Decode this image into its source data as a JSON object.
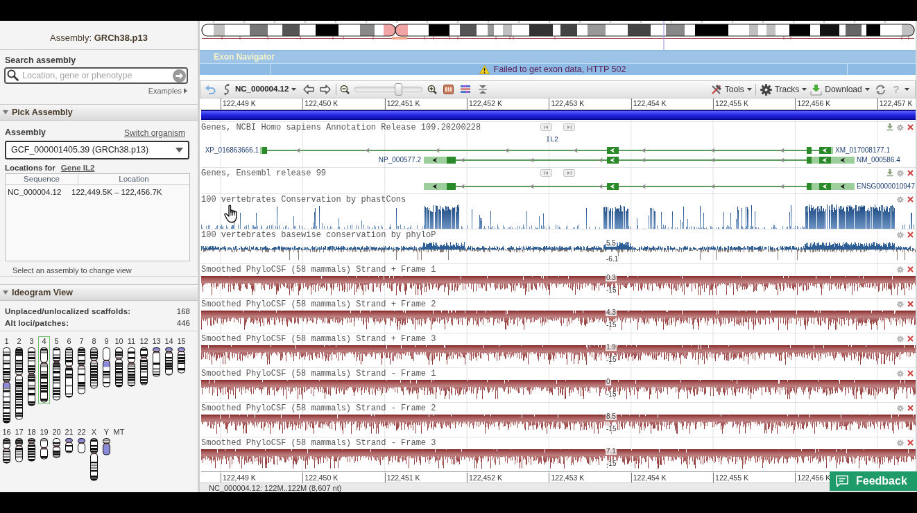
{
  "assembly_panel": {
    "title": "Assembly: **GRCh38.p13**"
  },
  "search": {
    "label": "Search assembly",
    "placeholder": "Location, gene or phenotype",
    "examples_link": "Examples"
  },
  "pick_assembly": {
    "title": "Pick Assembly",
    "expanded": true,
    "assembly_label": "Assembly",
    "switch_link": "Switch organism",
    "assembly_select": "GCF_000001405.39 (GRCh38.p13)",
    "locations_label": "Locations for",
    "gene_link": "Gene IL2",
    "table": {
      "columns": [
        "Sequence",
        "Location"
      ],
      "rows": [
        [
          "NC_000004.12",
          "122,449.5K – 122,456.7K"
        ]
      ]
    },
    "hint": "Select an assembly to change view"
  },
  "ideogram_view": {
    "title": "Ideogram View",
    "expanded": true,
    "stats": [
      {
        "label": "Unplaced/unlocalized scaffolds:",
        "value": "168"
      },
      {
        "label": "Alt loci/patches:",
        "value": "446"
      }
    ],
    "chromosomes": [
      {
        "name": "1",
        "selected": false
      },
      {
        "name": "2",
        "selected": false
      },
      {
        "name": "3",
        "selected": false
      },
      {
        "name": "4",
        "selected": true
      },
      {
        "name": "5",
        "selected": false
      },
      {
        "name": "6",
        "selected": false
      },
      {
        "name": "7",
        "selected": false
      },
      {
        "name": "8",
        "selected": false
      },
      {
        "name": "9",
        "selected": false
      },
      {
        "name": "10",
        "selected": false
      },
      {
        "name": "11",
        "selected": false
      },
      {
        "name": "12",
        "selected": false
      },
      {
        "name": "13",
        "selected": false
      },
      {
        "name": "14",
        "selected": false
      },
      {
        "name": "15",
        "selected": false
      },
      {
        "name": "16",
        "selected": false
      },
      {
        "name": "17",
        "selected": false
      },
      {
        "name": "18",
        "selected": false
      },
      {
        "name": "19",
        "selected": false
      },
      {
        "name": "20",
        "selected": false
      },
      {
        "name": "21",
        "selected": false
      },
      {
        "name": "22",
        "selected": false
      },
      {
        "name": "X",
        "selected": false
      },
      {
        "name": "Y",
        "selected": false
      },
      {
        "name": "MT",
        "selected": false
      }
    ]
  },
  "exon_navigator": {
    "title": "Exon Navigator",
    "message": "Failed to get exon data, HTTP 502"
  },
  "toolbar": {
    "sequence": "NC_000004.12",
    "zoom": {
      "level": 0.65
    },
    "menus": [
      "Tools",
      "Tracks",
      "Download"
    ],
    "help": "?"
  },
  "ruler_top": [
    "122,449 K",
    "122,450 K",
    "122,451 K",
    "122,452 K",
    "122,453 K",
    "122,454 K",
    "122,455 K",
    "122,456 K",
    "122,457 K"
  ],
  "tracks": [
    {
      "kind": "genes",
      "title": "Genes, NCBI Homo sapiens Annotation Release 109.20200228",
      "gene_label": "IL2",
      "transcripts": [
        {
          "kind": "long",
          "left_label": "XP_016863666.1",
          "right_label": "XM_017008177.1"
        },
        {
          "kind": "short",
          "left_label": "NP_000577.2",
          "right_label": "NM_000586.4"
        }
      ]
    },
    {
      "kind": "genes",
      "title": "Genes, Ensembl release 99",
      "transcripts": [
        {
          "kind": "short",
          "right_label": "ENSG0000010947"
        }
      ]
    },
    {
      "kind": "conservation",
      "title": "100 vertebrates Conservation by phastCons"
    },
    {
      "kind": "phylop",
      "title": "100 vertebrates basewise conservation by phyloP",
      "axis_max": "5.5",
      "axis_min": "-6.1"
    },
    {
      "kind": "phylocsf",
      "title": "Smoothed PhyloCSF (58 mammals) Strand + Frame 1",
      "axis_max": "0.3",
      "axis_min": "-15"
    },
    {
      "kind": "phylocsf",
      "title": "Smoothed PhyloCSF (58 mammals) Strand + Frame 2",
      "axis_max": "4.3",
      "axis_min": "-15"
    },
    {
      "kind": "phylocsf",
      "title": "Smoothed PhyloCSF (58 mammals) Strand + Frame 3",
      "axis_max": "1.9",
      "axis_min": "-15"
    },
    {
      "kind": "phylocsf",
      "title": "Smoothed PhyloCSF (58 mammals) Strand - Frame 1",
      "axis_max": "0",
      "axis_min": "-15"
    },
    {
      "kind": "phylocsf",
      "title": "Smoothed PhyloCSF (58 mammals) Strand - Frame 2",
      "axis_max": "8.5",
      "axis_min": "-15"
    },
    {
      "kind": "phylocsf",
      "title": "Smoothed PhyloCSF (58 mammals) Strand - Frame 3",
      "axis_max": "7.1",
      "axis_min": "-15"
    }
  ],
  "ruler_bottom": [
    "122,449 K",
    "122,450 K",
    "122,451 K",
    "122,452 K",
    "122,453 K",
    "122,454 K",
    "122,455 K",
    "122,456 K"
  ],
  "status_bar": "NC_000004.12: 122M..122M (8,607 nt)",
  "feedback_button": "Feedback"
}
